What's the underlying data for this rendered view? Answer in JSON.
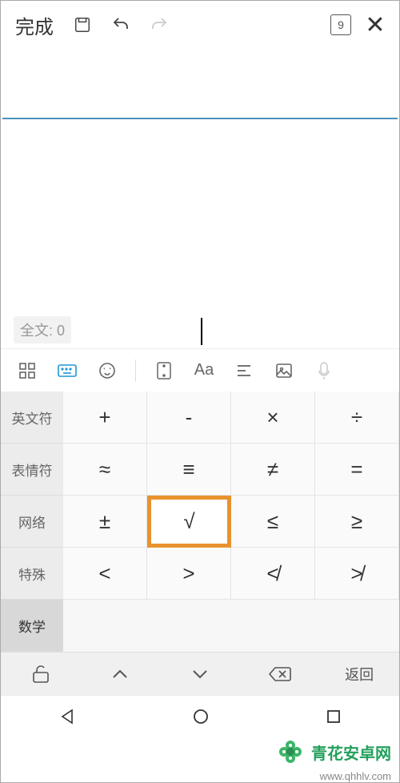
{
  "toolbar": {
    "done_label": "完成",
    "page_number": "9"
  },
  "document": {
    "word_count_label": "全文: 0"
  },
  "categories": [
    {
      "label": "英文符"
    },
    {
      "label": "表情符"
    },
    {
      "label": "网络"
    },
    {
      "label": "特殊"
    },
    {
      "label": "数学",
      "selected": true
    }
  ],
  "symbols": {
    "rows": [
      [
        "+",
        "-",
        "×",
        "÷"
      ],
      [
        "≈",
        "≡",
        "≠",
        "="
      ],
      [
        "±",
        "√",
        "≤",
        "≥"
      ],
      [
        "<",
        ">",
        "≮",
        "≯"
      ]
    ],
    "highlighted": "√"
  },
  "bottom": {
    "back_label": "返回"
  },
  "watermark": {
    "text": "青花安卓网",
    "url": "www.qhhlv.com"
  }
}
